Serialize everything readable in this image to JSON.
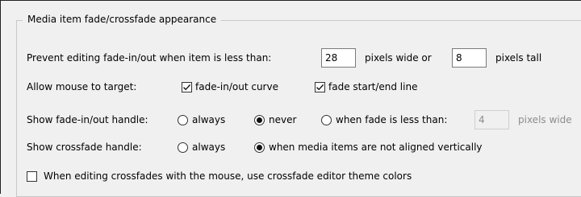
{
  "group": {
    "title": "Media item fade/crossfade appearance"
  },
  "prevent": {
    "label": "Prevent editing fade-in/out when item is less than:",
    "width_value": "28",
    "wide_label": "pixels wide or",
    "height_value": "8",
    "tall_label": "pixels tall"
  },
  "target": {
    "label": "Allow mouse to target:",
    "opt_curve": {
      "label": "fade-in/out curve",
      "checked": true
    },
    "opt_line": {
      "label": "fade start/end line",
      "checked": true
    }
  },
  "fade_handle": {
    "label": "Show fade-in/out handle:",
    "opt_always": "always",
    "opt_never": "never",
    "opt_when": "when fade is less than:",
    "selected": "never",
    "threshold_value": "4",
    "threshold_unit": "pixels wide"
  },
  "crossfade_handle": {
    "label": "Show crossfade handle:",
    "opt_always": "always",
    "opt_aligned": "when media items are not aligned vertically",
    "selected": "aligned"
  },
  "theme_colors": {
    "label": "When editing crossfades with the mouse, use crossfade editor theme colors",
    "checked": false
  }
}
